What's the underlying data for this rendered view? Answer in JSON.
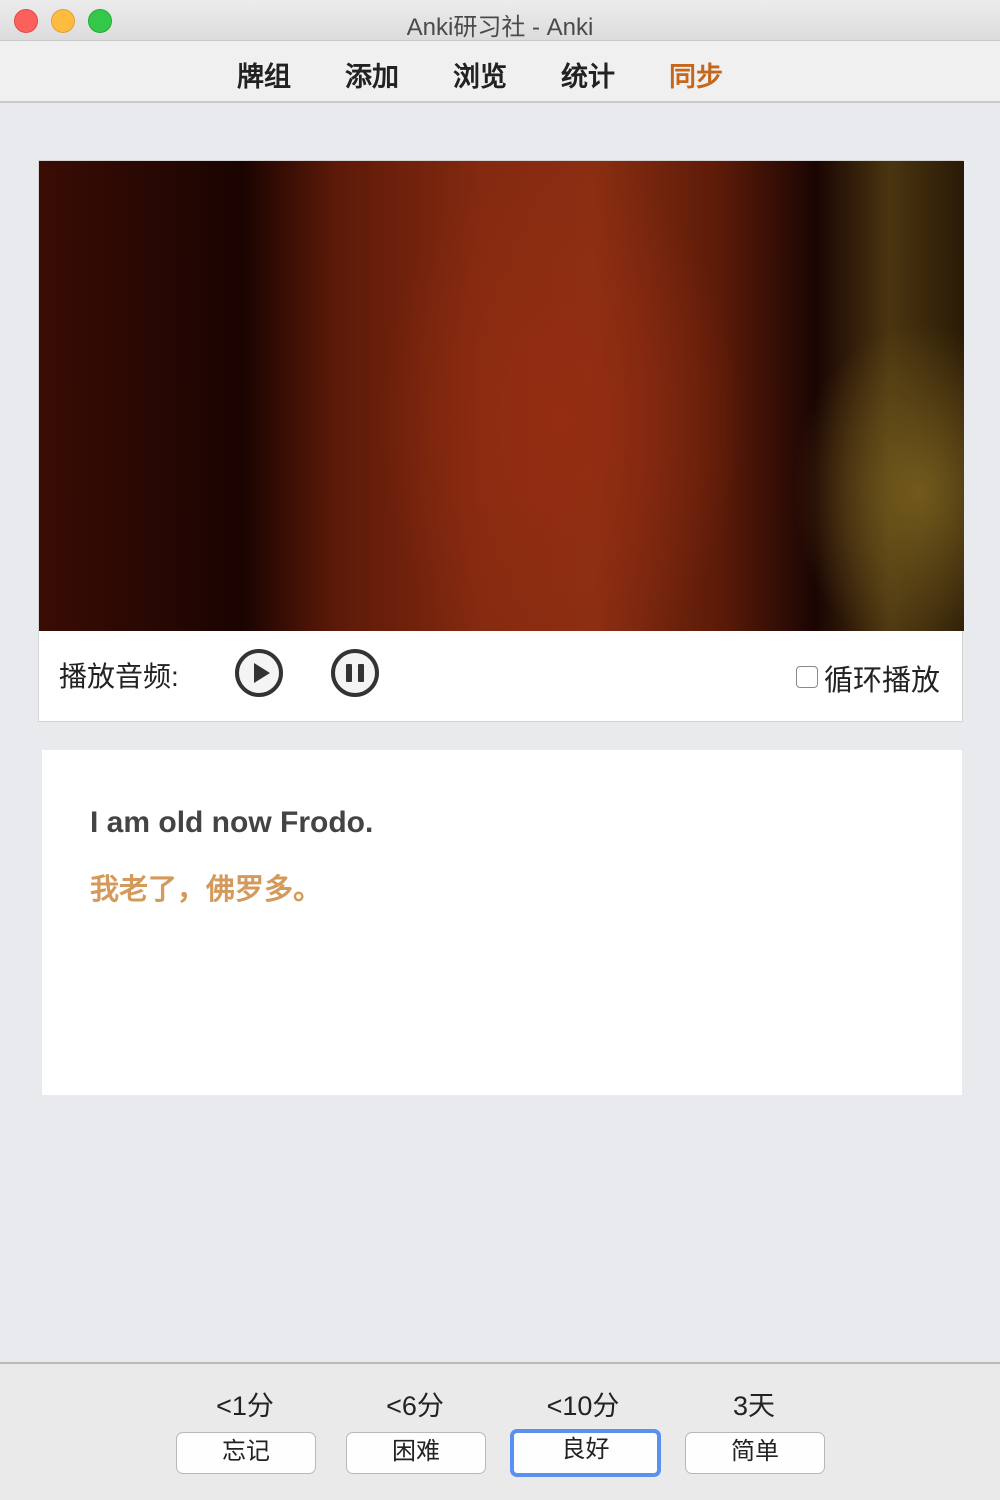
{
  "window": {
    "title": "Anki研习社 - Anki"
  },
  "toolbar": {
    "items": [
      {
        "label": "牌组"
      },
      {
        "label": "添加"
      },
      {
        "label": "浏览"
      },
      {
        "label": "统计"
      },
      {
        "label": "同步"
      }
    ],
    "active_color": "#c5661b"
  },
  "player": {
    "label": "播放音频:",
    "play_icon": "play-icon",
    "pause_icon": "pause-icon",
    "loop_label": "循环播放",
    "loop_checked": false
  },
  "card": {
    "english": "I am old now Frodo.",
    "chinese": "我老了，佛罗多。",
    "chinese_color": "#d49a5c"
  },
  "answers": [
    {
      "interval": "<1分",
      "label": "忘记"
    },
    {
      "interval": "<6分",
      "label": "困难"
    },
    {
      "interval": "<10分",
      "label": "良好",
      "focused": true
    },
    {
      "interval": "3天",
      "label": "简单"
    }
  ],
  "focus_color": "#5a90f0"
}
